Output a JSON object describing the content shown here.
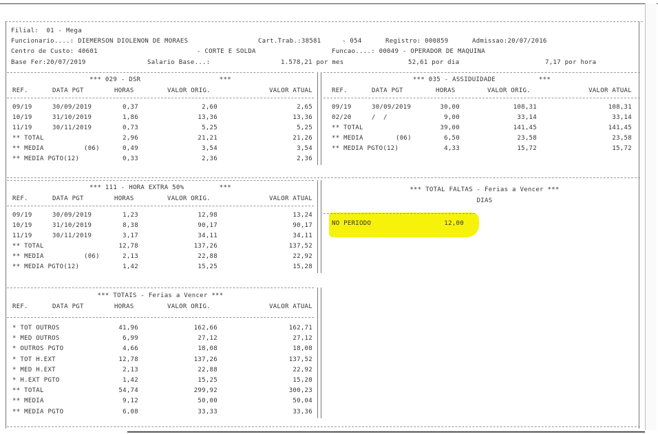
{
  "header": {
    "line1": "Filial:  01 - Mega",
    "func_label": "Funcionario....: DIEMERSON DIOLENON DE MORAES",
    "cart": "Cart.Trab.:38581",
    "cart2": "- 054",
    "registro": "Registro: 000859",
    "admissao": "Admissao:20/07/2016",
    "centro": "Centro de Custo: 40601",
    "centro_desc": "- CORTE E SOLDA",
    "funcao": "Funcao....: 00049 - OPERADOR DE MAQUINA",
    "base": "Base Fer:20/07/2019",
    "salario_label": "Salario Base...:",
    "salario_mes": "1.578,21 por mes",
    "salario_dia": "52,61 por dia",
    "salario_hora": "7,17 por hora"
  },
  "cols": {
    "ref": "REF.",
    "data": "DATA PGT",
    "horas": "HORAS",
    "vorig": "VALOR ORIG.",
    "vatual": "VALOR ATUAL"
  },
  "dsr": {
    "title": "*** 029 - DSR                    ***",
    "rows": [
      [
        "09/19",
        "30/09/2019",
        "0,37",
        "2,60",
        "2,65"
      ],
      [
        "10/19",
        "31/10/2019",
        "1,86",
        "13,36",
        "13,36"
      ],
      [
        "11/19",
        "30/11/2019",
        "0,73",
        "5,25",
        "5,25"
      ],
      [
        "** TOTAL",
        "",
        "2,96",
        "21,21",
        "21,26"
      ],
      [
        "** MEDIA",
        "(06)",
        "0,49",
        "3,54",
        "3,54"
      ],
      [
        "** MEDIA PGTO(12)",
        "",
        "0,33",
        "2,36",
        "2,36"
      ]
    ]
  },
  "assid": {
    "title": "*** 035 - ASSIDUIDADE           ***",
    "rows": [
      [
        "09/19",
        "30/09/2019",
        "30,00",
        "108,31",
        "108,31"
      ],
      [
        "02/20",
        "/  /",
        "9,00",
        "33,14",
        "33,14"
      ],
      [
        "** TOTAL",
        "",
        "39,00",
        "141,45",
        "141,45"
      ],
      [
        "** MEDIA",
        "(06)",
        "6,50",
        "23,58",
        "23,58"
      ],
      [
        "** MEDIA PGTO(12)",
        "",
        "4,33",
        "15,72",
        "15,72"
      ]
    ]
  },
  "hextra": {
    "title": "*** 111 - HORA EXTRA 50%         ***",
    "rows": [
      [
        "09/19",
        "30/09/2019",
        "1,23",
        "12,98",
        "13,24"
      ],
      [
        "10/19",
        "31/10/2019",
        "8,38",
        "90,17",
        "90,17"
      ],
      [
        "11/19",
        "30/11/2019",
        "3,17",
        "34,11",
        "34,11"
      ],
      [
        "** TOTAL",
        "",
        "12,78",
        "137,26",
        "137,52"
      ],
      [
        "** MEDIA",
        "(06)",
        "2,13",
        "22,88",
        "22,92"
      ],
      [
        "** MEDIA PGTO(12)",
        "",
        "1,42",
        "15,25",
        "15,28"
      ]
    ]
  },
  "faltas": {
    "title": "*** TOTAL FALTAS - Ferias a Vencer ***",
    "dias": "DIAS",
    "label": "NO PERIODO",
    "value": "12,00",
    "highlight_color": "#f6f20a"
  },
  "totais": {
    "title": "*** TOTAIS - Ferias a Vencer ***",
    "rows": [
      [
        "* TOT OUTROS",
        "41,96",
        "162,66",
        "162,71"
      ],
      [
        "* MED OUTROS",
        "6,99",
        "27,12",
        "27,12"
      ],
      [
        "* OUTROS PGTO",
        "4,66",
        "18,08",
        "18,08"
      ],
      [
        "* TOT H.EXT",
        "12,78",
        "137,26",
        "137,52"
      ],
      [
        "* MED H.EXT",
        "2,13",
        "22,88",
        "22,92"
      ],
      [
        "* H.EXT PGTO",
        "1,42",
        "15,25",
        "15,28"
      ],
      [
        "** TOTAL",
        "54,74",
        "299,92",
        "300,23"
      ],
      [
        "** MEDIA",
        "9,12",
        "50,00",
        "50,04"
      ],
      [
        "** MEDIA PGTO",
        "6,08",
        "33,33",
        "33,36"
      ]
    ]
  }
}
